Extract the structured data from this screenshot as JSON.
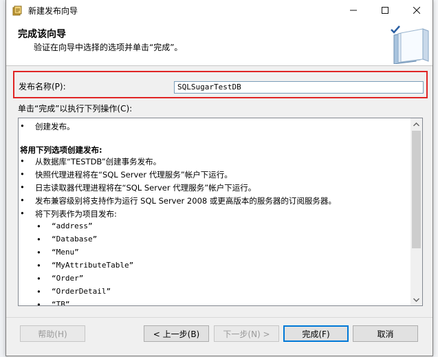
{
  "window": {
    "title": "新建发布向导"
  },
  "header": {
    "title": "完成该向导",
    "subtitle": "验证在向导中选择的选项并单击“完成”。"
  },
  "publication": {
    "name_label": "发布名称(P):",
    "name_value": "SQLSugarTestDB"
  },
  "actions_label": "单击“完成”以执行下列操作(C):",
  "summary": {
    "bullet": "•",
    "create": "创建发布。",
    "section_title": "将用下列选项创建发布:",
    "options": [
      "从数据库“TESTDB”创建事务发布。",
      "快照代理进程将在“SQL Server 代理服务”帐户下运行。",
      "日志读取器代理进程将在“SQL Server 代理服务”帐户下运行。",
      "发布兼容级别将支持作为运行 SQL Server 2008 或更高版本的服务器的订阅服务器。",
      "将下列表作为项目发布:"
    ],
    "articles": [
      "“address”",
      "“Database”",
      "“Menu”",
      "“MyAttributeTable”",
      "“Order”",
      "“OrderDetail”",
      "“TB”"
    ]
  },
  "buttons": {
    "help": "帮助(H)",
    "back": "< 上一步(B)",
    "next": "下一步(N) >",
    "finish": "完成(F)",
    "cancel": "取消"
  },
  "colors": {
    "highlight_border": "#e02424",
    "primary_button_border": "#0078d7"
  }
}
